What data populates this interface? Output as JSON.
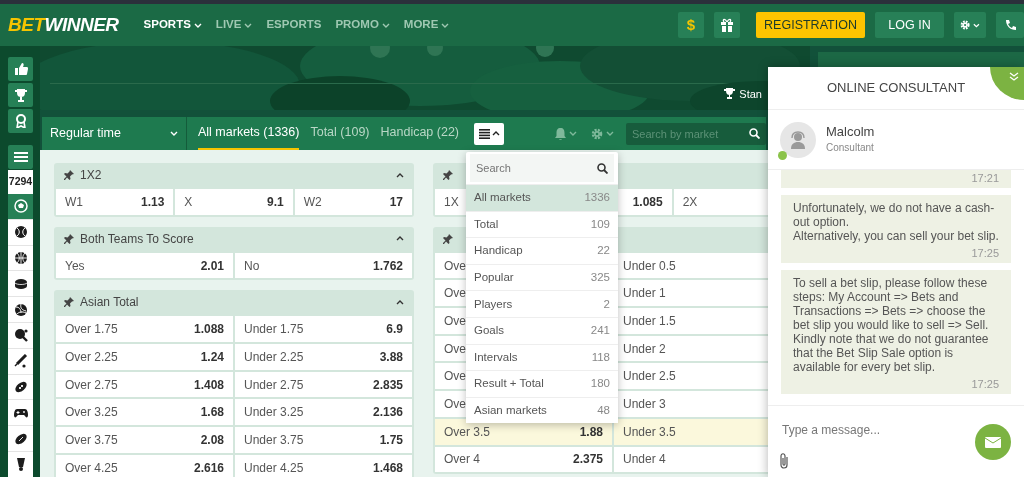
{
  "header": {
    "logo": {
      "part_1": "BET",
      "part_2": "WINNER"
    },
    "nav": [
      {
        "label": "SPORTS",
        "selected": true,
        "dropdown": true
      },
      {
        "label": "LIVE",
        "selected": false,
        "dropdown": true
      },
      {
        "label": "ESPORTS",
        "selected": false,
        "dropdown": false
      },
      {
        "label": "PROMO",
        "selected": false,
        "dropdown": true
      },
      {
        "label": "MORE",
        "selected": false,
        "dropdown": true
      }
    ],
    "deposit_symbol": "$",
    "register_button": "REGISTRATION",
    "login_button": "LOG IN"
  },
  "sidebar": {
    "counter": "7294",
    "sports": [
      {
        "selected": true
      },
      {
        "selected": false
      },
      {
        "selected": false
      },
      {
        "selected": false
      },
      {
        "selected": false
      },
      {
        "selected": false
      },
      {
        "selected": false
      },
      {
        "selected": false
      },
      {
        "selected": false
      },
      {
        "selected": false
      },
      {
        "selected": false
      }
    ]
  },
  "banner": {
    "standings_link": "Stan"
  },
  "toolbar": {
    "period": "Regular time",
    "tabs": [
      {
        "label": "All markets (1336)",
        "selected": true
      },
      {
        "label": "Total (109)",
        "selected": false
      },
      {
        "label": "Handicap (22)",
        "selected": false
      }
    ],
    "market_list_open": true,
    "search": {
      "placeholder": "Search by market"
    }
  },
  "market_menu": {
    "search": {
      "placeholder": "Search"
    },
    "items": [
      {
        "label": "All markets",
        "count": "1336",
        "selected": true
      },
      {
        "label": "Total",
        "count": "109",
        "selected": false
      },
      {
        "label": "Handicap",
        "count": "22",
        "selected": false
      },
      {
        "label": "Popular",
        "count": "325",
        "selected": false
      },
      {
        "label": "Players",
        "count": "2",
        "selected": false
      },
      {
        "label": "Goals",
        "count": "241",
        "selected": false
      },
      {
        "label": "Intervals",
        "count": "118",
        "selected": false
      },
      {
        "label": "Result + Total",
        "count": "180",
        "selected": false
      },
      {
        "label": "Asian markets",
        "count": "48",
        "selected": false
      }
    ]
  },
  "columns": [
    {
      "groups": [
        {
          "title": "1X2",
          "expanded": true,
          "rows": [
            {
              "highlighted": false,
              "cells": [
                {
                  "label": "W1",
                  "odds": "1.13"
                },
                {
                  "label": "X",
                  "odds": "9.1"
                },
                {
                  "label": "W2",
                  "odds": "17"
                }
              ]
            }
          ]
        },
        {
          "title": "Both Teams To Score",
          "expanded": true,
          "rows": [
            {
              "highlighted": false,
              "cells": [
                {
                  "label": "Yes",
                  "odds": "2.01"
                },
                {
                  "label": "No",
                  "odds": "1.762"
                }
              ]
            }
          ]
        },
        {
          "title": "Asian Total",
          "expanded": true,
          "rows": [
            {
              "highlighted": false,
              "cells": [
                {
                  "label": "Over 1.75",
                  "odds": "1.088"
                },
                {
                  "label": "Under 1.75",
                  "odds": "6.9"
                }
              ]
            },
            {
              "highlighted": false,
              "cells": [
                {
                  "label": "Over 2.25",
                  "odds": "1.24"
                },
                {
                  "label": "Under 2.25",
                  "odds": "3.88"
                }
              ]
            },
            {
              "highlighted": false,
              "cells": [
                {
                  "label": "Over 2.75",
                  "odds": "1.408"
                },
                {
                  "label": "Under 2.75",
                  "odds": "2.835"
                }
              ]
            },
            {
              "highlighted": false,
              "cells": [
                {
                  "label": "Over 3.25",
                  "odds": "1.68"
                },
                {
                  "label": "Under 3.25",
                  "odds": "2.136"
                }
              ]
            },
            {
              "highlighted": false,
              "cells": [
                {
                  "label": "Over 3.75",
                  "odds": "2.08"
                },
                {
                  "label": "Under 3.75",
                  "odds": "1.75"
                }
              ]
            },
            {
              "highlighted": false,
              "cells": [
                {
                  "label": "Over 4.25",
                  "odds": "2.616"
                },
                {
                  "label": "Under 4.25",
                  "odds": "1.468"
                }
              ]
            }
          ]
        }
      ]
    },
    {
      "groups": [
        {
          "rows": [
            {
              "highlighted": false,
              "cells": [
                {
                  "label": "1X"
                },
                {
                  "odds": "1.085"
                },
                {
                  "label": "2X"
                }
              ]
            }
          ]
        },
        {
          "rows": [
            {
              "highlighted": false,
              "cells": [
                {
                  "label": "Ove"
                },
                {
                  "label": "Under 0.5"
                }
              ]
            },
            {
              "highlighted": false,
              "cells": [
                {
                  "label": "Ove"
                },
                {
                  "label": "Under 1"
                }
              ]
            },
            {
              "highlighted": false,
              "cells": [
                {
                  "label": "Ove"
                },
                {
                  "label": "Under 1.5"
                }
              ]
            },
            {
              "highlighted": false,
              "cells": [
                {
                  "label": "Ove"
                },
                {
                  "label": "Under 2"
                }
              ]
            },
            {
              "highlighted": false,
              "cells": [
                {
                  "label": "Ove"
                },
                {
                  "label": "Under 2.5"
                }
              ]
            },
            {
              "highlighted": false,
              "cells": [
                {
                  "label": "Ove"
                },
                {
                  "label": "Under 3"
                }
              ]
            },
            {
              "highlighted": true,
              "cells": [
                {
                  "label": "Over 3.5",
                  "odds": "1.88"
                },
                {
                  "label": "Under 3.5"
                }
              ]
            },
            {
              "highlighted": false,
              "cells": [
                {
                  "label": "Over 4",
                  "odds": "2.375"
                },
                {
                  "label": "Under 4"
                }
              ]
            }
          ]
        }
      ]
    }
  ],
  "chat": {
    "title": "ONLINE CONSULTANT",
    "agent": {
      "name": "Malcolm",
      "role": "Consultant",
      "online": true
    },
    "messages": [
      {
        "time": "17:21"
      },
      {
        "text": "Unfortunately, we do not have a cash-out option.\nAlternatively, you can sell your bet slip.",
        "time": "17:25"
      },
      {
        "text": "To sell a bet slip, please follow these steps: My Account => Bets and Transactions => Bets => choose the bet slip you would like to sell => Sell. Kindly note that we do not guarantee that the Bet Slip Sale option is available for every bet slip.",
        "time": "17:25"
      }
    ],
    "input": {
      "placeholder": "Type a message..."
    }
  }
}
